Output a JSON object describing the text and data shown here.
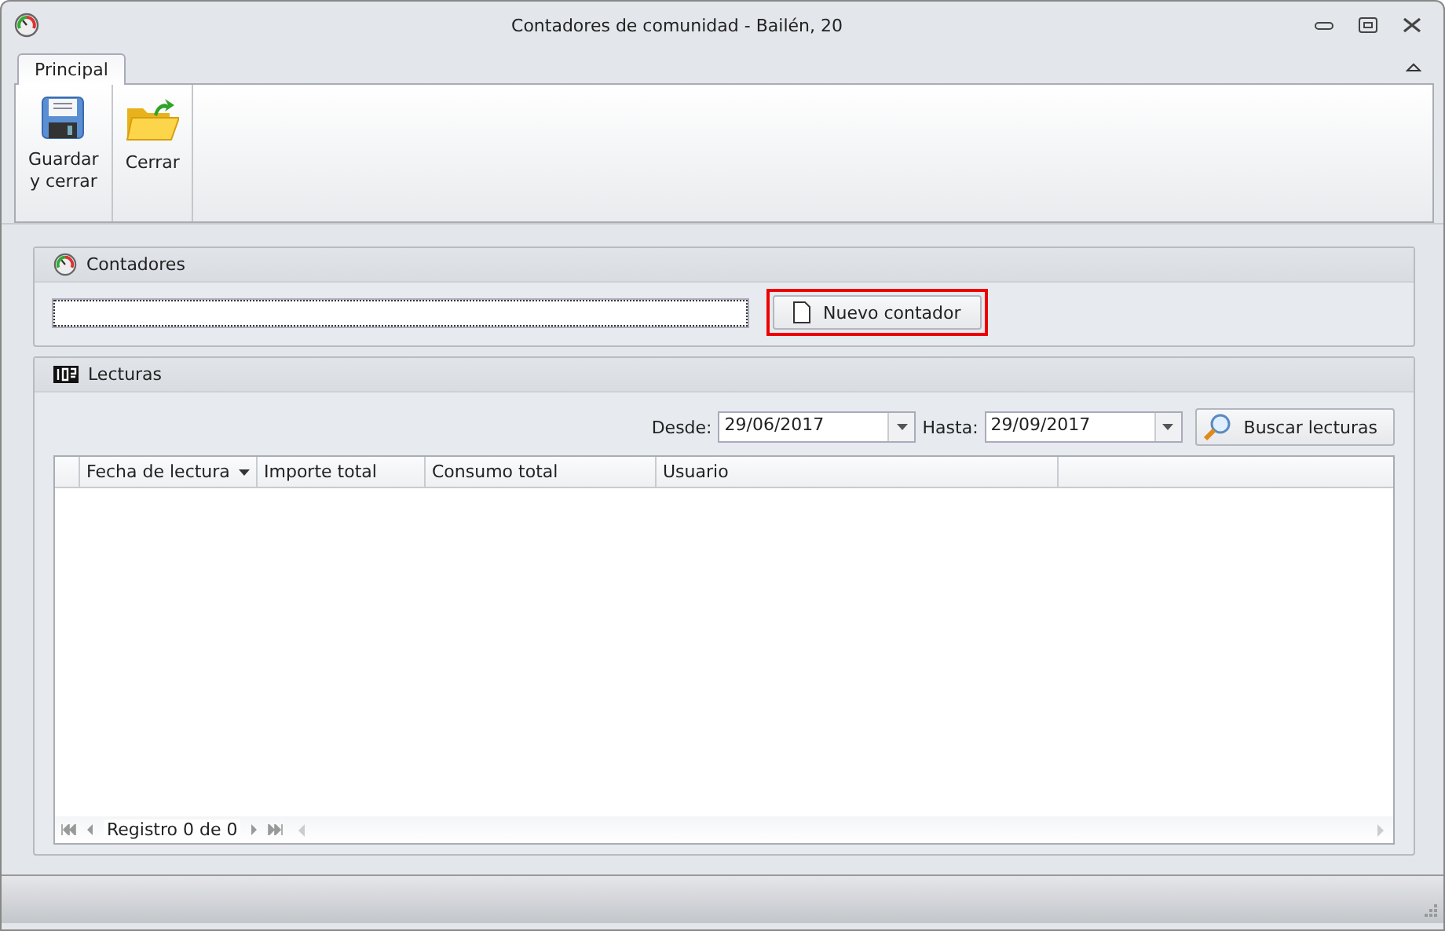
{
  "window": {
    "title": "Contadores de comunidad - Bailén, 20"
  },
  "tabs": [
    {
      "label": "Principal",
      "selected": true
    }
  ],
  "ribbon": {
    "buttons": [
      {
        "label": "Guardar\ny cerrar",
        "kind": "save"
      },
      {
        "label": "Cerrar",
        "kind": "close"
      }
    ]
  },
  "contadores": {
    "title": "Contadores",
    "new_button": {
      "label": "Nuevo contador",
      "highlighted": true
    }
  },
  "lecturas": {
    "title": "Lecturas",
    "desde_label": "Desde:",
    "desde": "29/06/2017",
    "hasta_label": "Hasta:",
    "hasta": "29/09/2017",
    "search_button": "Buscar lecturas",
    "table": {
      "columns": [
        {
          "label": "Fecha de lectura",
          "sorted": true
        },
        {
          "label": "Importe total",
          "sorted": false
        },
        {
          "label": "Consumo total",
          "sorted": false
        },
        {
          "label": "Usuario",
          "sorted": false
        }
      ]
    },
    "navigator": "Registro 0 de 0"
  }
}
